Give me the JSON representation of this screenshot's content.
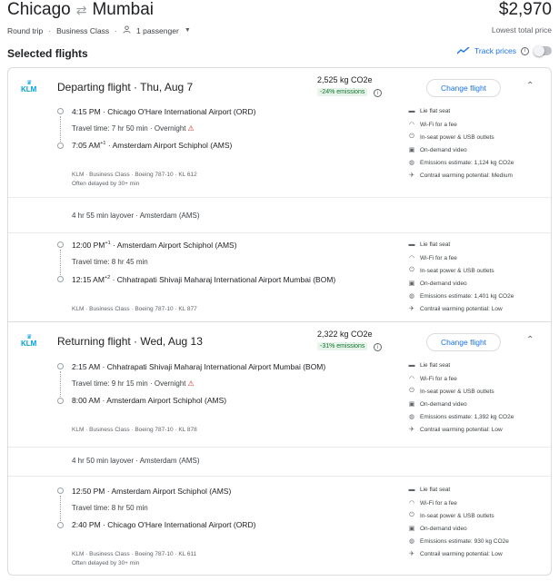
{
  "header": {
    "origin": "Chicago",
    "destination": "Mumbai",
    "swap_icon": "swap-arrows-icon",
    "price": "$2,970",
    "price_note": "Lowest total price",
    "trip_type": "Round trip",
    "cabin": "Business Class",
    "passengers": "1 passenger"
  },
  "section": {
    "title": "Selected flights",
    "track_label": "Track prices"
  },
  "departing": {
    "title": "Departing flight · Thu, Aug 7",
    "co2": "2,525 kg CO2e",
    "co2_badge": "-24% emissions",
    "change_label": "Change flight",
    "seg1": {
      "dep": "4:15 PM",
      "dep_airport": "Chicago O'Hare International Airport (ORD)",
      "travel": "Travel time: 7 hr 50 min",
      "overnight": "Overnight",
      "arr": "7:05 AM",
      "arr_sup": "+1",
      "arr_airport": "Amsterdam Airport Schiphol (AMS)",
      "details": "KLM · Business Class · Boeing 787-10 · KL 612",
      "delay": "Often delayed by 30+ min",
      "amenities": [
        "Lie flat seat",
        "Wi-Fi for a fee",
        "In-seat power & USB outlets",
        "On-demand video",
        "Emissions estimate: 1,124 kg CO2e",
        "Contrail warming potential: Medium"
      ]
    },
    "layover": "4 hr 55 min layover · Amsterdam (AMS)",
    "seg2": {
      "dep": "12:00 PM",
      "dep_sup": "+1",
      "dep_airport": "Amsterdam Airport Schiphol (AMS)",
      "travel": "Travel time: 8 hr 45 min",
      "arr": "12:15 AM",
      "arr_sup": "+2",
      "arr_airport": "Chhatrapati Shivaji Maharaj International Airport Mumbai (BOM)",
      "details": "KLM · Business Class · Boeing 787-10 · KL 877",
      "amenities": [
        "Lie flat seat",
        "Wi-Fi for a fee",
        "In-seat power & USB outlets",
        "On-demand video",
        "Emissions estimate: 1,401 kg CO2e",
        "Contrail warming potential: Low"
      ]
    }
  },
  "returning": {
    "title": "Returning flight · Wed, Aug 13",
    "co2": "2,322 kg CO2e",
    "co2_badge": "-31% emissions",
    "change_label": "Change flight",
    "seg1": {
      "dep": "2:15 AM",
      "dep_airport": "Chhatrapati Shivaji Maharaj International Airport Mumbai (BOM)",
      "travel": "Travel time: 9 hr 15 min",
      "overnight": "Overnight",
      "arr": "8:00 AM",
      "arr_airport": "Amsterdam Airport Schiphol (AMS)",
      "details": "KLM · Business Class · Boeing 787-10 · KL 878",
      "amenities": [
        "Lie flat seat",
        "Wi-Fi for a fee",
        "In-seat power & USB outlets",
        "On-demand video",
        "Emissions estimate: 1,392 kg CO2e",
        "Contrail warming potential: Low"
      ]
    },
    "layover": "4 hr 50 min layover · Amsterdam (AMS)",
    "seg2": {
      "dep": "12:50 PM",
      "dep_airport": "Amsterdam Airport Schiphol (AMS)",
      "travel": "Travel time: 8 hr 50 min",
      "arr": "2:40 PM",
      "arr_airport": "Chicago O'Hare International Airport (ORD)",
      "details": "KLM · Business Class · Boeing 787-10 · KL 611",
      "delay": "Often delayed by 30+ min",
      "amenities": [
        "Lie flat seat",
        "Wi-Fi for a fee",
        "In-seat power & USB outlets",
        "On-demand video",
        "Emissions estimate: 930 kg CO2e",
        "Contrail warming potential: Low"
      ]
    }
  },
  "airline_logo": "KLM",
  "colors": {
    "accent": "#1a73e8",
    "klm": "#00a1de",
    "badge_bg": "#e6f4ea",
    "badge_fg": "#137333",
    "warn": "#d93025"
  }
}
